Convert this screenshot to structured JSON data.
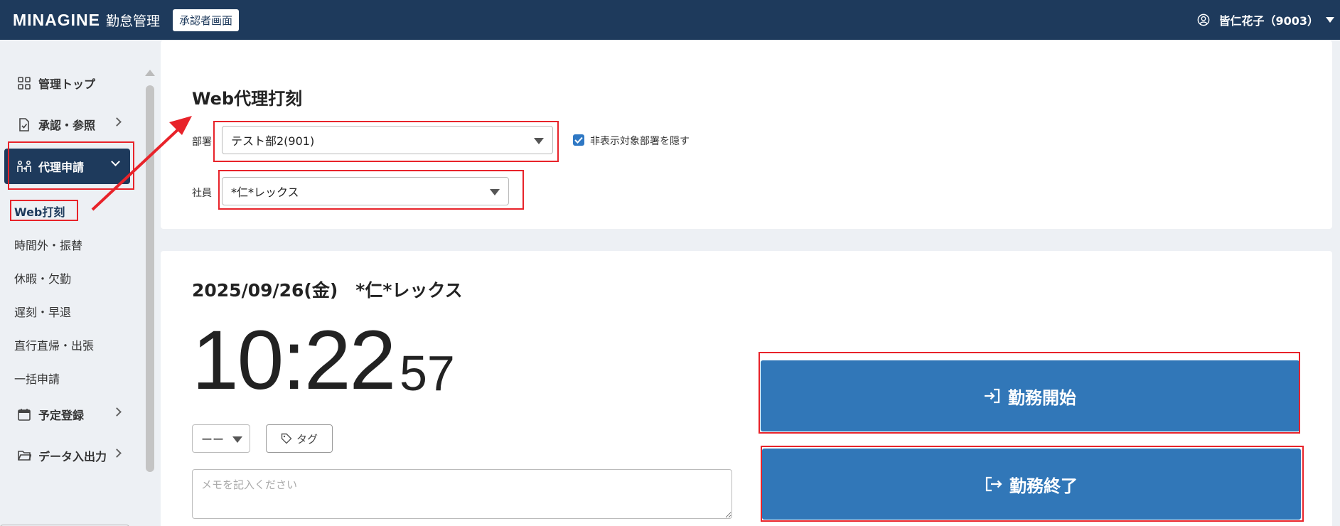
{
  "header": {
    "logo": "MINAGINE",
    "app_name": "勤怠管理",
    "approver_badge": "承認者画面",
    "user_name": "皆仁花子（9003）"
  },
  "sidebar": {
    "items": [
      {
        "label": "管理トップ",
        "icon": "grid-icon"
      },
      {
        "label": "承認・参照",
        "icon": "document-check-icon"
      },
      {
        "label": "代理申請",
        "icon": "proxy-people-icon"
      },
      {
        "label": "予定登録",
        "icon": "calendar-icon"
      },
      {
        "label": "データ入出力",
        "icon": "folder-icon"
      }
    ],
    "sub_items": [
      "Web打刻",
      "時間外・振替",
      "休暇・欠勤",
      "遅刻・早退",
      "直行直帰・出張",
      "一括申請"
    ]
  },
  "punch_form": {
    "title": "Web代理打刻",
    "department_label": "部署",
    "department_value": "テスト部2(901)",
    "hide_departments_label": "非表示対象部署を隠す",
    "hide_departments_checked": true,
    "employee_label": "社員",
    "employee_value": "*仁*レックス"
  },
  "clock": {
    "date_heading": "2025/09/26(金)　*仁*レックス",
    "hours_minutes": "10:22",
    "seconds": "57",
    "type_select_value": "ーー",
    "tag_label": "タグ",
    "memo_placeholder": "メモを記入ください",
    "start_button": "勤務開始",
    "end_button": "勤務終了"
  },
  "colors": {
    "header_bg": "#1e3a5c",
    "primary_button": "#3177b8",
    "annotation_red": "#e8232a",
    "checkbox": "#2f78c4"
  }
}
